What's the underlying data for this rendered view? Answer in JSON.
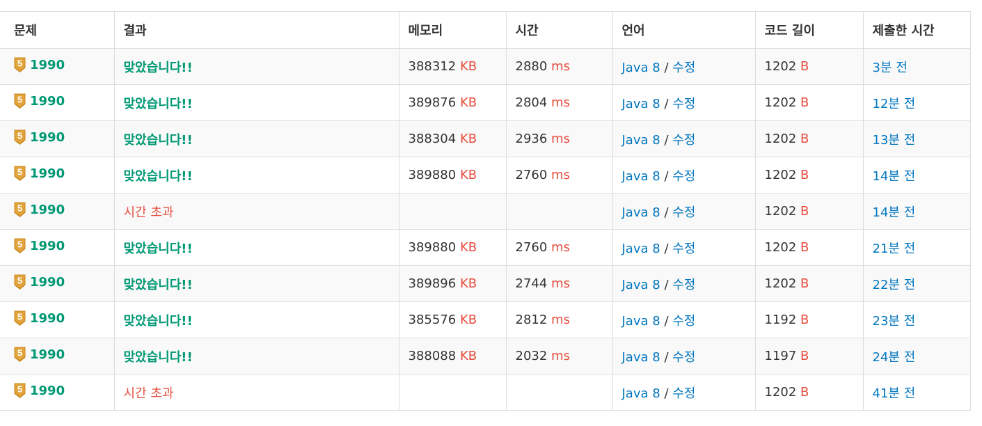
{
  "headers": {
    "problem": "문제",
    "result": "결과",
    "memory": "메모리",
    "time": "시간",
    "language": "언어",
    "code_length": "코드 길이",
    "submitted": "제출한 시간"
  },
  "colors": {
    "accepted": "#009874",
    "error": "#e74c3c",
    "link": "#0076c0",
    "tier_badge": "#e2a33b"
  },
  "units": {
    "memory": "KB",
    "time": "ms",
    "length": "B"
  },
  "rows": [
    {
      "tier_icon": "tier-gold-5-icon",
      "tier_num": "5",
      "problem": "1990",
      "result": "맞았습니다!!",
      "status": "ac",
      "memory": "388312",
      "time": "2880",
      "language": "Java 8",
      "sep": "/",
      "edit": "수정",
      "length": "1202",
      "submitted": "3분 전"
    },
    {
      "tier_icon": "tier-gold-5-icon",
      "tier_num": "5",
      "problem": "1990",
      "result": "맞았습니다!!",
      "status": "ac",
      "memory": "389876",
      "time": "2804",
      "language": "Java 8",
      "sep": "/",
      "edit": "수정",
      "length": "1202",
      "submitted": "12분 전"
    },
    {
      "tier_icon": "tier-gold-5-icon",
      "tier_num": "5",
      "problem": "1990",
      "result": "맞았습니다!!",
      "status": "ac",
      "memory": "388304",
      "time": "2936",
      "language": "Java 8",
      "sep": "/",
      "edit": "수정",
      "length": "1202",
      "submitted": "13분 전"
    },
    {
      "tier_icon": "tier-gold-5-icon",
      "tier_num": "5",
      "problem": "1990",
      "result": "맞았습니다!!",
      "status": "ac",
      "memory": "389880",
      "time": "2760",
      "language": "Java 8",
      "sep": "/",
      "edit": "수정",
      "length": "1202",
      "submitted": "14분 전"
    },
    {
      "tier_icon": "tier-gold-5-icon",
      "tier_num": "5",
      "problem": "1990",
      "result": "시간 초과",
      "status": "tle",
      "memory": "",
      "time": "",
      "language": "Java 8",
      "sep": "/",
      "edit": "수정",
      "length": "1202",
      "submitted": "14분 전"
    },
    {
      "tier_icon": "tier-gold-5-icon",
      "tier_num": "5",
      "problem": "1990",
      "result": "맞았습니다!!",
      "status": "ac",
      "memory": "389880",
      "time": "2760",
      "language": "Java 8",
      "sep": "/",
      "edit": "수정",
      "length": "1202",
      "submitted": "21분 전"
    },
    {
      "tier_icon": "tier-gold-5-icon",
      "tier_num": "5",
      "problem": "1990",
      "result": "맞았습니다!!",
      "status": "ac",
      "memory": "389896",
      "time": "2744",
      "language": "Java 8",
      "sep": "/",
      "edit": "수정",
      "length": "1202",
      "submitted": "22분 전"
    },
    {
      "tier_icon": "tier-gold-5-icon",
      "tier_num": "5",
      "problem": "1990",
      "result": "맞았습니다!!",
      "status": "ac",
      "memory": "385576",
      "time": "2812",
      "language": "Java 8",
      "sep": "/",
      "edit": "수정",
      "length": "1192",
      "submitted": "23분 전"
    },
    {
      "tier_icon": "tier-gold-5-icon",
      "tier_num": "5",
      "problem": "1990",
      "result": "맞았습니다!!",
      "status": "ac",
      "memory": "388088",
      "time": "2032",
      "language": "Java 8",
      "sep": "/",
      "edit": "수정",
      "length": "1197",
      "submitted": "24분 전"
    },
    {
      "tier_icon": "tier-gold-5-icon",
      "tier_num": "5",
      "problem": "1990",
      "result": "시간 초과",
      "status": "tle",
      "memory": "",
      "time": "",
      "language": "Java 8",
      "sep": "/",
      "edit": "수정",
      "length": "1202",
      "submitted": "41분 전"
    }
  ]
}
